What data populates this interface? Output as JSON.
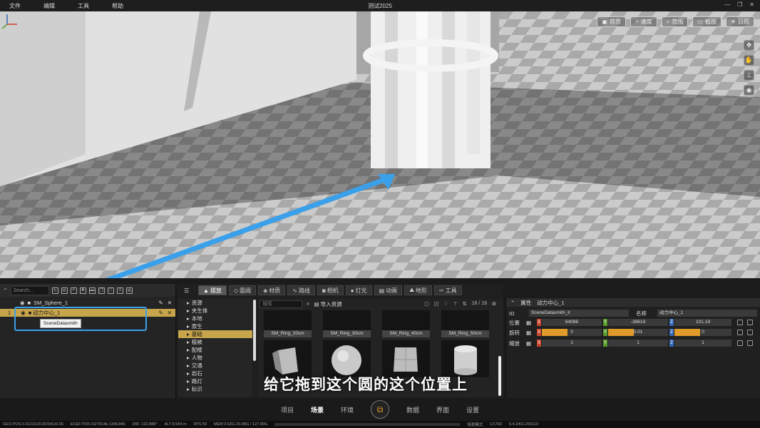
{
  "titlebar": {
    "menus": [
      "文件",
      "编辑",
      "工具",
      "帮助"
    ],
    "title": "测试2025"
  },
  "viewport_toolbar": [
    "首页",
    "速度",
    "范围",
    "截图",
    "日照"
  ],
  "outliner": {
    "search_placeholder": "Search...",
    "rows": [
      {
        "index": "",
        "name": "SM_Sphere_1"
      },
      {
        "index": "1",
        "name": "动力中心_1"
      }
    ],
    "tooltip": "SceneDatasmith"
  },
  "content": {
    "tabs": [
      "摆放",
      "圍阈",
      "材质",
      "路线",
      "相机",
      "灯光",
      "动画",
      "地形",
      "工具"
    ],
    "categories": [
      "资源",
      "夹生体",
      "本地",
      "原生",
      "基础",
      "植被",
      "配楼",
      "人物",
      "交通",
      "岩石",
      "路灯",
      "标识"
    ],
    "active_category": "基础",
    "asset_search_placeholder": "搜索",
    "import_label": "导入资源",
    "count": "16 / 16",
    "thumbs": [
      "SM_Ring_20cm",
      "SM_Ring_30cm",
      "SM_Ring_40cm",
      "SM_Ring_50cm"
    ]
  },
  "subtitle": "给它拖到这个圆的这个位置上",
  "props": {
    "header": "属性",
    "object_name": "动力中心_1",
    "id_label": "ID",
    "id_value": "SceneDatasmith_it",
    "name_label": "名称",
    "name_value": "动力中心_1",
    "rows": [
      {
        "label": "位置",
        "x": "64088",
        "y": "-38619",
        "z": "101.19"
      },
      {
        "label": "旋转",
        "x": "0",
        "y": "0.01",
        "z": "0"
      },
      {
        "label": "缩放",
        "x": "1",
        "y": "1",
        "z": "1"
      }
    ]
  },
  "bottomnav": [
    "项目",
    "场景",
    "环境",
    "数据",
    "界面",
    "设置"
  ],
  "active_nav": "场景",
  "statusbar": {
    "geo": "GEO POS  0.01211U0.007b6U6.55",
    "ecef": "ECEF POS  63/7814b,1348,846",
    "dir": "DIR  -132.888°",
    "alt": "ALT  8.554 m",
    "fps": "FPS  59",
    "mem": "MEM  3.52G  26.9BG / 127.89G",
    "mode": "场景模式",
    "page": "1/1760",
    "version": "6.4.2402.250113"
  }
}
